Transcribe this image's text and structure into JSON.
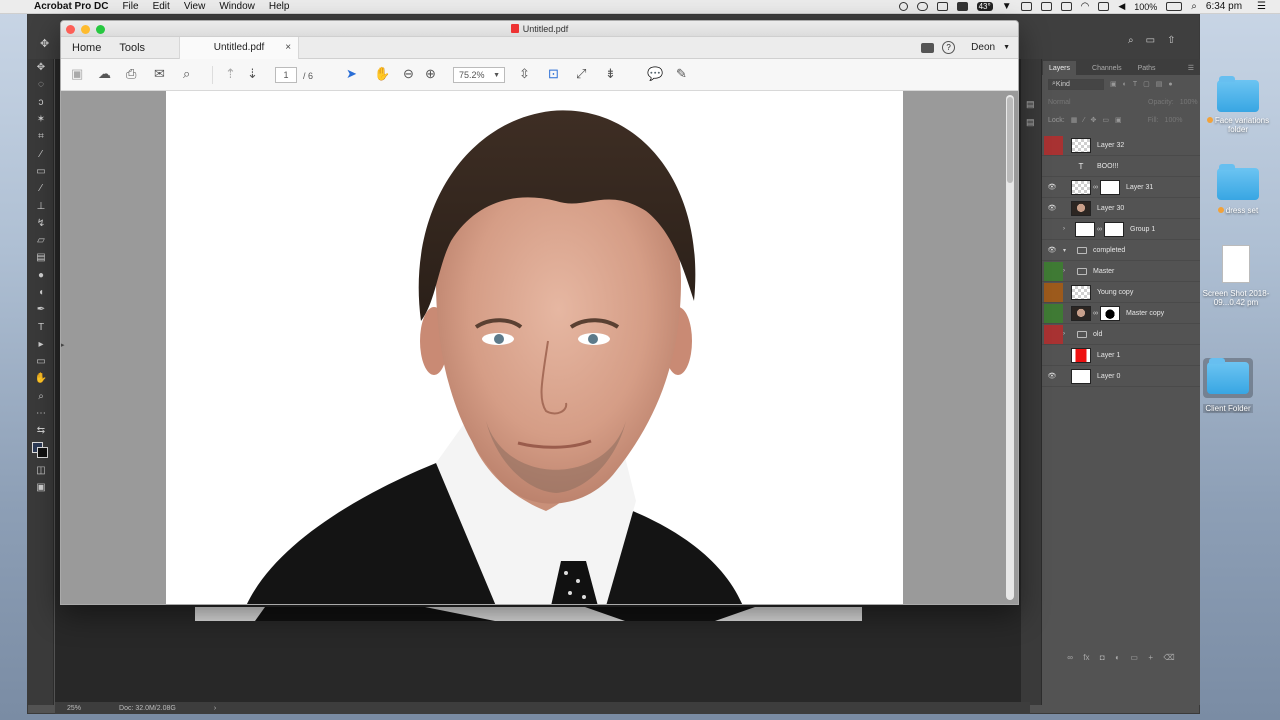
{
  "menubar": {
    "app_name": "Acrobat Pro DC",
    "items": [
      "File",
      "Edit",
      "View",
      "Window",
      "Help"
    ],
    "temperature": "43°",
    "battery": "100%",
    "time": "6:34 pm"
  },
  "acrobat": {
    "window_title": "Untitled.pdf",
    "tabs": {
      "home": "Home",
      "tools": "Tools",
      "document": "Untitled.pdf"
    },
    "user": "Deon",
    "page_current": "1",
    "page_total": "/ 6",
    "zoom": "75.2%"
  },
  "photoshop": {
    "panel_tabs": [
      "Layers",
      "Channels",
      "Paths"
    ],
    "filter_kind": "Kind",
    "blend_mode": "Normal",
    "opacity_label": "Opacity:",
    "opacity_value": "100%",
    "lock_label": "Lock:",
    "fill_label": "Fill:",
    "fill_value": "100%",
    "layers": [
      {
        "name": "Layer 32",
        "color": "#a83232",
        "visible": false,
        "thumb": "checker"
      },
      {
        "name": "BOO!!!",
        "color": "",
        "visible": false,
        "thumb": "text"
      },
      {
        "name": "Layer 31",
        "color": "",
        "visible": true,
        "thumb": "checker-mask"
      },
      {
        "name": "Layer 30",
        "color": "",
        "visible": true,
        "thumb": "face"
      },
      {
        "name": "Group 1",
        "color": "",
        "visible": false,
        "thumb": "group-mask"
      },
      {
        "name": "completed",
        "color": "",
        "visible": true,
        "thumb": "folder-open"
      },
      {
        "name": "Master",
        "color": "#3f7a34",
        "visible": false,
        "thumb": "folder"
      },
      {
        "name": "Young copy",
        "color": "#9c5a1c",
        "visible": false,
        "thumb": "checker"
      },
      {
        "name": "Master copy",
        "color": "#3f7a34",
        "visible": false,
        "thumb": "face-mask"
      },
      {
        "name": "old",
        "color": "#a83232",
        "visible": false,
        "thumb": "folder"
      },
      {
        "name": "Layer 1",
        "color": "",
        "visible": false,
        "thumb": "red"
      },
      {
        "name": "Layer 0",
        "color": "",
        "visible": true,
        "thumb": "white"
      }
    ],
    "status_zoom": "25%",
    "status_doc": "Doc: 32.0M/2.08G"
  },
  "desktop": {
    "icons": [
      {
        "label": "Face variations folder",
        "type": "folder",
        "tag": true
      },
      {
        "label": "dress set",
        "type": "folder",
        "tag": true
      },
      {
        "label": "Screen Shot 2018-09...0.42 pm",
        "type": "file",
        "tag": false
      },
      {
        "label": "Client Folder",
        "type": "folder",
        "tag": false
      }
    ]
  }
}
